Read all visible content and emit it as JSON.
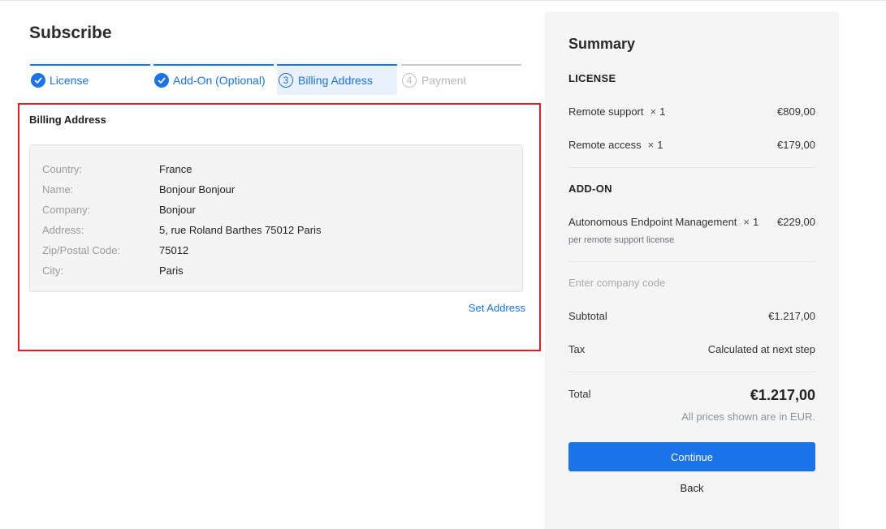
{
  "page": {
    "title": "Subscribe"
  },
  "steps": [
    {
      "label": "License",
      "state": "done"
    },
    {
      "label": "Add-On (Optional)",
      "state": "done"
    },
    {
      "label": "Billing Address",
      "number": "3",
      "state": "current"
    },
    {
      "label": "Payment",
      "number": "4",
      "state": "upcoming"
    }
  ],
  "billing": {
    "title": "Billing Address",
    "fields": [
      {
        "label": "Country:",
        "value": "France"
      },
      {
        "label": "Name:",
        "value": "Bonjour Bonjour"
      },
      {
        "label": "Company:",
        "value": "Bonjour"
      },
      {
        "label": "Address:",
        "value": "5, rue Roland Barthes 75012 Paris"
      },
      {
        "label": "Zip/Postal Code:",
        "value": "75012"
      },
      {
        "label": "City:",
        "value": "Paris"
      }
    ],
    "set_address_label": "Set Address"
  },
  "summary": {
    "title": "Summary",
    "license_heading": "LICENSE",
    "license_items": [
      {
        "name": "Remote support",
        "times": "×",
        "qty": "1",
        "price": "€809,00"
      },
      {
        "name": "Remote access",
        "times": "×",
        "qty": "1",
        "price": "€179,00"
      }
    ],
    "addon_heading": "ADD-ON",
    "addon_items": [
      {
        "name": "Autonomous Endpoint Management",
        "times": "×",
        "qty": "1",
        "price": "€229,00",
        "note": "per remote support license"
      }
    ],
    "company_code_placeholder": "Enter company code",
    "subtotal_label": "Subtotal",
    "subtotal_value": "€1.217,00",
    "tax_label": "Tax",
    "tax_value": "Calculated at next step",
    "total_label": "Total",
    "total_value": "€1.217,00",
    "price_note": "All prices shown are in EUR.",
    "continue_label": "Continue",
    "back_label": "Back"
  },
  "colors": {
    "accent": "#1a73e8",
    "highlight_border": "#e02025",
    "summary_bg": "#f5f5f5"
  }
}
